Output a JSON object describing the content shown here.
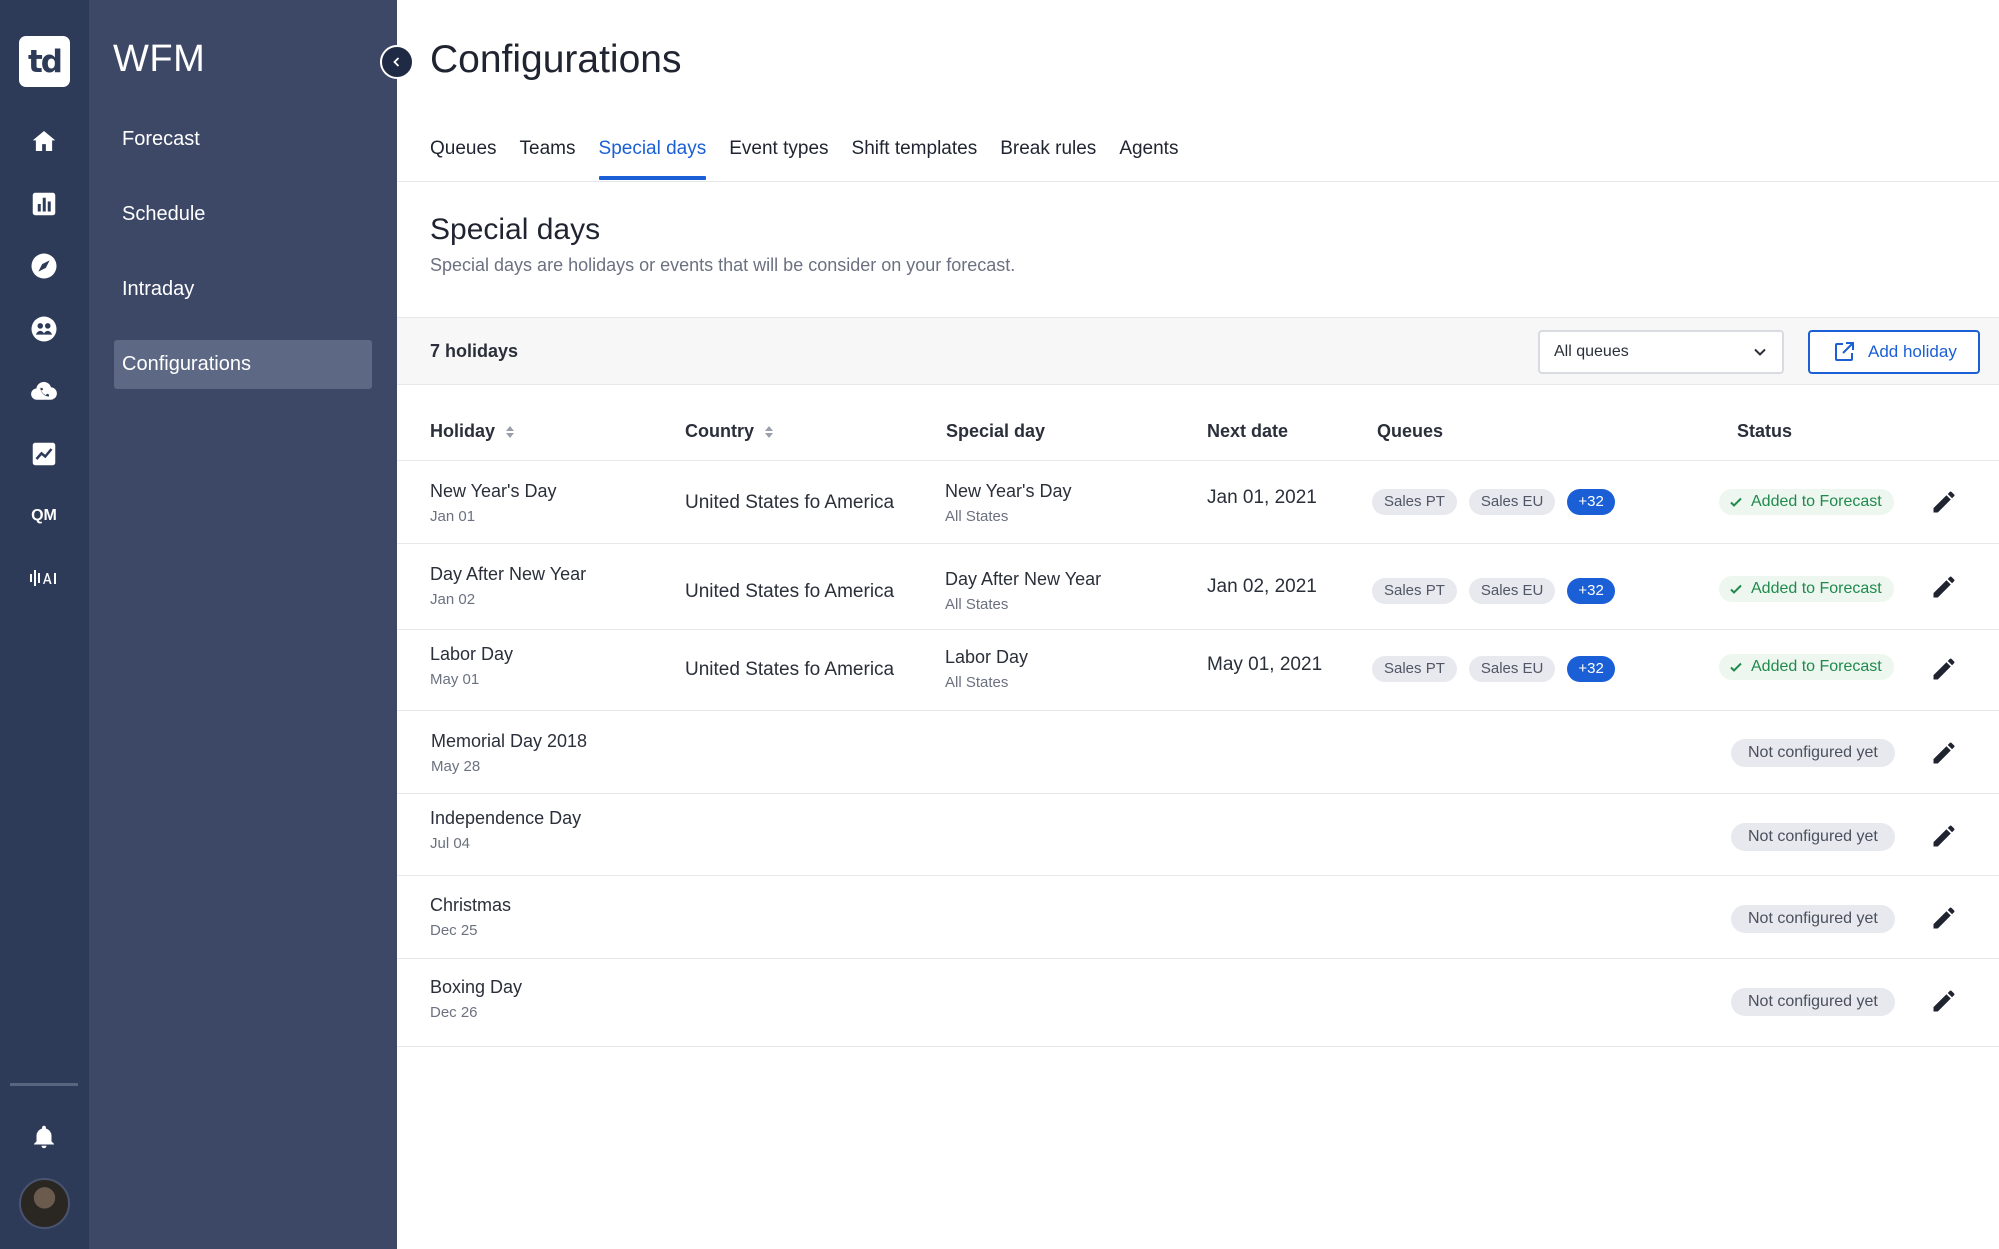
{
  "rail": {
    "logo": "td",
    "qm_label": "QM",
    "icons": [
      "home-icon",
      "bar-chart-icon",
      "compass-icon",
      "people-icon",
      "cloud-phone-icon",
      "trend-chart-icon",
      "qm-icon",
      "voice-ai-icon",
      "bell-icon"
    ]
  },
  "nav": {
    "app_title": "WFM",
    "items": [
      {
        "label": "Forecast"
      },
      {
        "label": "Schedule"
      },
      {
        "label": "Intraday"
      },
      {
        "label": "Configurations",
        "active": true
      }
    ]
  },
  "page": {
    "title": "Configurations",
    "tabs": [
      {
        "label": "Queues"
      },
      {
        "label": "Teams"
      },
      {
        "label": "Special days",
        "active": true
      },
      {
        "label": "Event types"
      },
      {
        "label": "Shift templates"
      },
      {
        "label": "Break rules"
      },
      {
        "label": "Agents"
      }
    ],
    "section_title": "Special days",
    "section_desc": "Special days are holidays or events that will be consider on your forecast."
  },
  "toolbar": {
    "count": "7 holidays",
    "queue_select": "All queues",
    "add_label": "Add holiday"
  },
  "table": {
    "headers": {
      "holiday": "Holiday",
      "country": "Country",
      "special_day": "Special day",
      "next_date": "Next date",
      "queues": "Queues",
      "status": "Status"
    },
    "rows": [
      {
        "name": "New Year's Day",
        "date": "Jan 01",
        "country": "United States fo America",
        "special": "New Year's Day",
        "region": "All States",
        "next_date": "Jan 01, 2021",
        "queues": [
          "Sales PT",
          "Sales EU"
        ],
        "more": "+32",
        "status": "Added to Forecast"
      },
      {
        "name": "Day After New Year",
        "date": "Jan 02",
        "country": "United States fo America",
        "special": "Day After New Year",
        "region": "All States",
        "next_date": "Jan 02, 2021",
        "queues": [
          "Sales PT",
          "Sales EU"
        ],
        "more": "+32",
        "status": "Added to Forecast"
      },
      {
        "name": "Labor Day",
        "date": "May 01",
        "country": "United States fo America",
        "special": "Labor Day",
        "region": "All States",
        "next_date": "May 01, 2021",
        "queues": [
          "Sales PT",
          "Sales EU"
        ],
        "more": "+32",
        "status": "Added to Forecast"
      },
      {
        "name": "Memorial Day 2018",
        "date": "May 28",
        "status": "Not configured yet"
      },
      {
        "name": "Independence Day",
        "date": "Jul 04",
        "status": "Not configured yet"
      },
      {
        "name": "Christmas",
        "date": "Dec 25",
        "status": "Not configured yet"
      },
      {
        "name": "Boxing Day",
        "date": "Dec 26",
        "status": "Not configured yet"
      }
    ]
  },
  "colors": {
    "rail_bg": "#2d3a58",
    "nav_bg": "#3d4867",
    "accent": "#1a5fd6",
    "success": "#1f8a4c"
  }
}
